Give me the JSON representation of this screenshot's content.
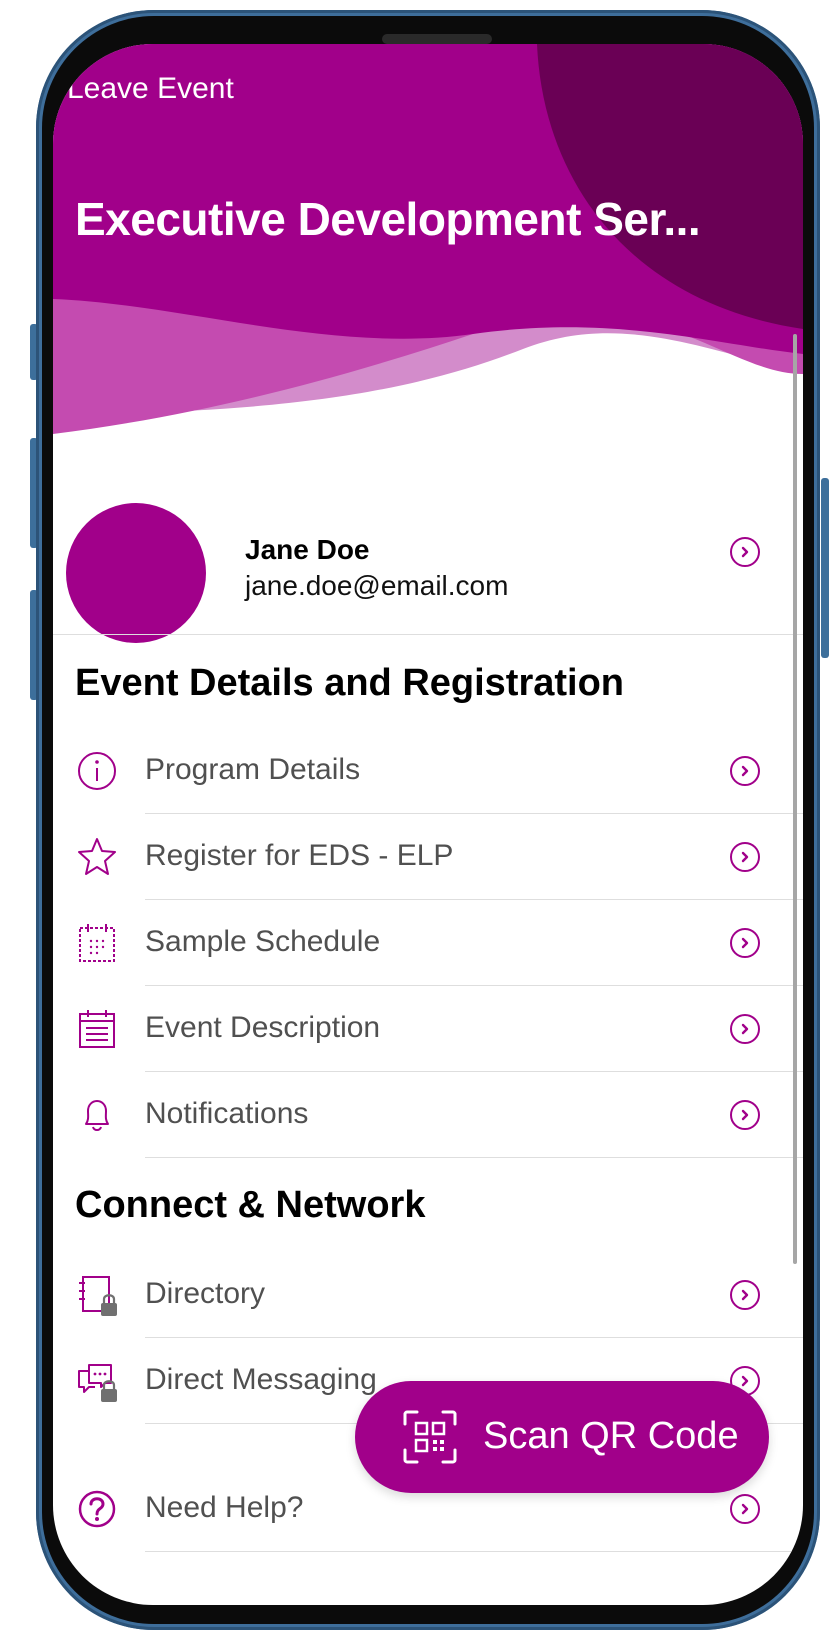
{
  "header": {
    "back_label": "Leave Event",
    "event_title": "Executive Development Ser..."
  },
  "profile": {
    "name": "Jane Doe",
    "email": "jane.doe@email.com"
  },
  "sections": [
    {
      "title": "Event Details and Registration",
      "items": [
        {
          "label": "Program Details",
          "icon": "info-icon"
        },
        {
          "label": "Register for EDS - ELP",
          "icon": "star-icon"
        },
        {
          "label": "Sample Schedule",
          "icon": "calendar-icon"
        },
        {
          "label": "Event Description",
          "icon": "document-calendar-icon"
        },
        {
          "label": "Notifications",
          "icon": "bell-icon"
        }
      ]
    },
    {
      "title": "Connect & Network",
      "items": [
        {
          "label": "Directory",
          "icon": "locked-directory-icon"
        },
        {
          "label": "Direct Messaging",
          "icon": "locked-message-icon"
        },
        {
          "label": "Need Help?",
          "icon": "question-icon"
        }
      ]
    }
  ],
  "fab": {
    "label": "Scan QR Code",
    "icon": "qr-code-icon"
  },
  "colors": {
    "brand": "#a1008a",
    "brand_dark": "#6a0055",
    "brand_light": "#d08ac8",
    "frame": "#3e6e9b"
  }
}
